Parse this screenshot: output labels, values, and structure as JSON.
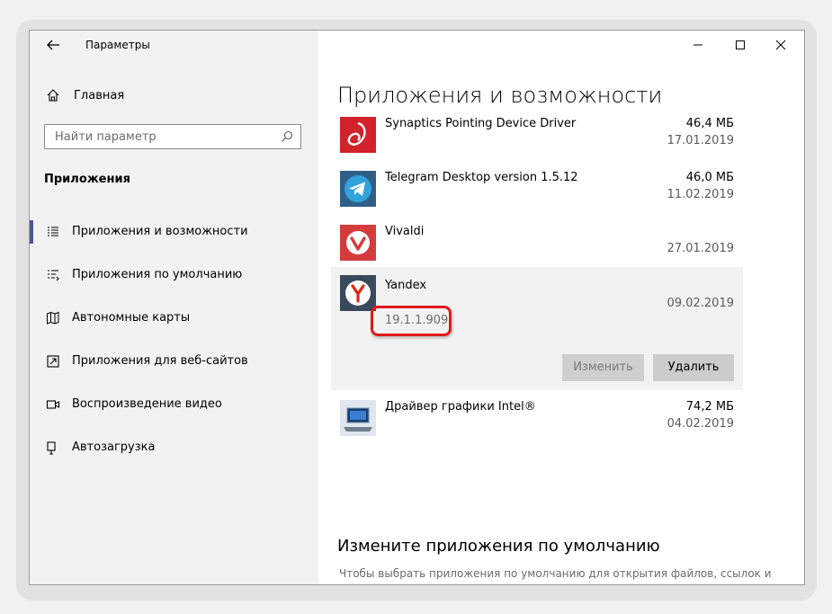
{
  "window": {
    "title": "Параметры",
    "controls": [
      "minimize-icon",
      "maximize-icon",
      "close-icon"
    ]
  },
  "sidebar": {
    "home_label": "Главная",
    "search_placeholder": "Найти параметр",
    "section_title": "Приложения",
    "items": [
      {
        "label": "Приложения и возможности",
        "icon": "apps-features-icon",
        "selected": true
      },
      {
        "label": "Приложения по умолчанию",
        "icon": "default-apps-icon",
        "selected": false
      },
      {
        "label": "Автономные карты",
        "icon": "offline-maps-icon",
        "selected": false
      },
      {
        "label": "Приложения для веб-сайтов",
        "icon": "apps-for-websites-icon",
        "selected": false
      },
      {
        "label": "Воспроизведение видео",
        "icon": "video-playback-icon",
        "selected": false
      },
      {
        "label": "Автозагрузка",
        "icon": "startup-icon",
        "selected": false
      }
    ]
  },
  "main": {
    "title": "Приложения и возможности",
    "apps": [
      {
        "name": "Synaptics Pointing Device Driver",
        "size": "46,4 МБ",
        "date": "17.01.2019",
        "icon": "synaptics-icon"
      },
      {
        "name": "Telegram Desktop version 1.5.12",
        "size": "46,0 МБ",
        "date": "11.02.2019",
        "icon": "telegram-icon"
      },
      {
        "name": "Vivaldi",
        "size": "",
        "date": "27.01.2019",
        "icon": "vivaldi-icon"
      },
      {
        "name": "Yandex",
        "size": "",
        "date": "09.02.2019",
        "version": "19.1.1.909",
        "icon": "yandex-icon",
        "selected": true
      },
      {
        "name": "Драйвер графики Intel®",
        "size": "74,2 МБ",
        "date": "04.02.2019",
        "icon": "intel-graphics-icon"
      }
    ],
    "modify_label": "Изменить",
    "remove_label": "Удалить",
    "subsection_title": "Измените приложения по умолчанию",
    "subsection_text": "Чтобы выбрать приложения по умолчанию для открытия файлов, ссылок и"
  },
  "colors": {
    "sidebar_bg": "#f2f2f2",
    "selected_marker": "#4a5d8a",
    "highlight_red": "#e11b1b"
  }
}
